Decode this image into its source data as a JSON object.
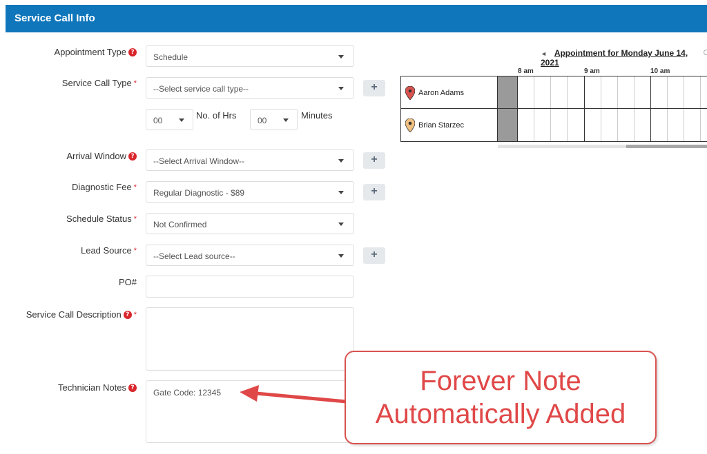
{
  "header": {
    "title": "Service Call Info"
  },
  "form": {
    "appointment_type": {
      "label": "Appointment Type",
      "value": "Schedule"
    },
    "service_call_type": {
      "label": "Service Call Type",
      "placeholder": "--Select service call type--"
    },
    "duration": {
      "hours_value": "00",
      "hours_label": "No. of Hrs",
      "minutes_value": "00",
      "minutes_label": "Minutes"
    },
    "arrival_window": {
      "label": "Arrival Window",
      "placeholder": "--Select Arrival Window--"
    },
    "diagnostic_fee": {
      "label": "Diagnostic Fee",
      "value": "Regular Diagnostic - $89"
    },
    "schedule_status": {
      "label": "Schedule Status",
      "value": "Not Confirmed"
    },
    "lead_source": {
      "label": "Lead Source",
      "placeholder": "--Select Lead source--"
    },
    "po": {
      "label": "PO#",
      "value": ""
    },
    "description": {
      "label": "Service Call Description",
      "value": ""
    },
    "technician_notes": {
      "label": "Technician Notes",
      "value": "Gate Code: 12345"
    },
    "plus_symbol": "+",
    "help_symbol": "?",
    "required_symbol": "*"
  },
  "scheduler": {
    "nav_arrow": "◄",
    "title": "Appointment for Monday June 14, 2021",
    "times": [
      "8 am",
      "9 am",
      "10 am"
    ],
    "technicians": [
      {
        "name": "Aaron Adams",
        "pin_color": "#d9534f"
      },
      {
        "name": "Brian Starzec",
        "pin_color": "#f0c080"
      }
    ]
  },
  "callout": {
    "line1": "Forever Note",
    "line2": "Automatically Added",
    "color": "#e04848"
  }
}
